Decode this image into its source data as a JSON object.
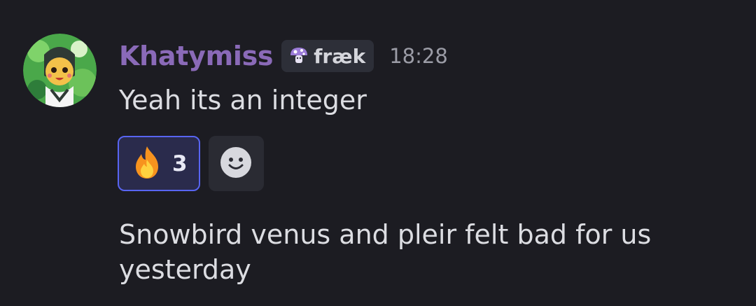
{
  "messages": [
    {
      "author": "Khatymiss",
      "role_tag": "fræk",
      "timestamp": "18:28",
      "text": "Yeah its an integer",
      "reactions": [
        {
          "emoji": "fire-emoji",
          "count": "3",
          "selected": true
        }
      ],
      "colors": {
        "author": "#8a6ab8",
        "reaction_border": "#5865f2"
      }
    },
    {
      "text": "Snowbird venus and pleir felt bad for us yesterday"
    }
  ],
  "icons": {
    "role": "mushroom-icon",
    "add_reaction": "smiley-face-icon"
  }
}
